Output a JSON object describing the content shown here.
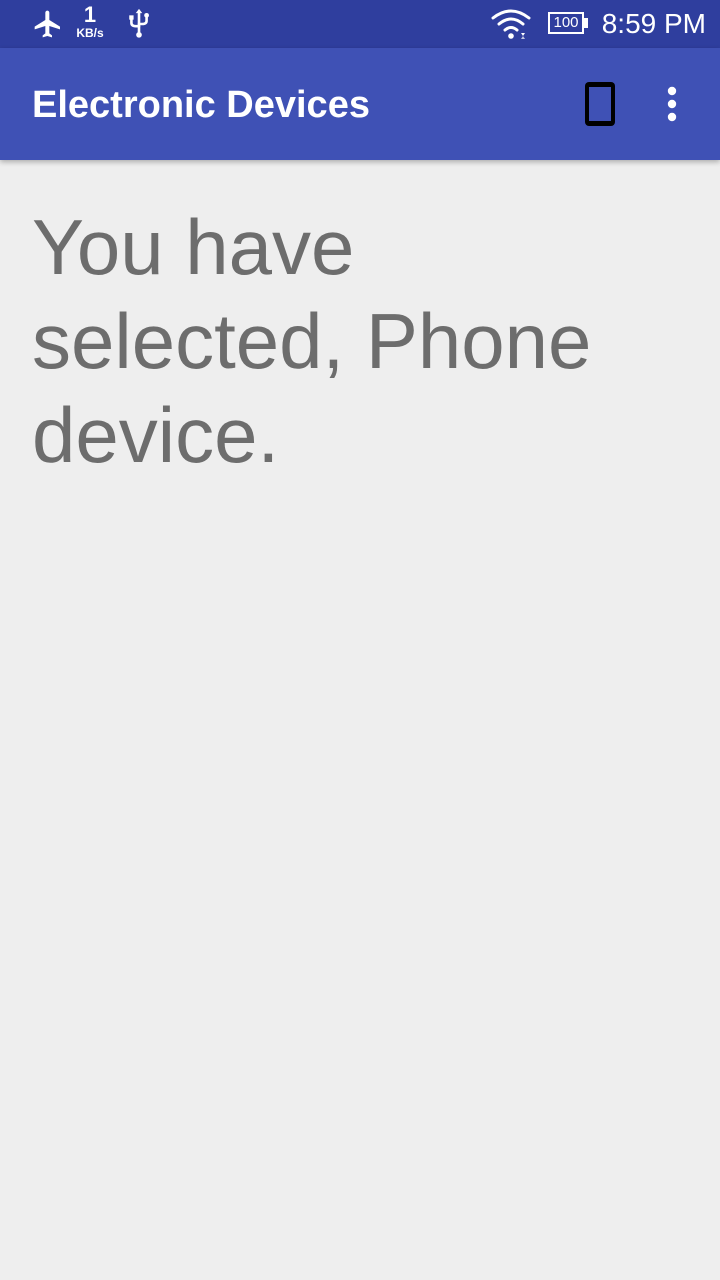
{
  "status_bar": {
    "airplane_icon": "airplane-icon",
    "net_speed_value": "1",
    "net_speed_unit": "KB/s",
    "usb_icon": "usb-icon",
    "wifi_icon": "wifi-icon",
    "battery_level": "100",
    "time": "8:59 PM"
  },
  "app_bar": {
    "title": "Electronic Devices",
    "actions": [
      {
        "icon": "phone-icon"
      },
      {
        "icon": "more-vert-icon"
      }
    ],
    "background_color": "#3f51b5"
  },
  "main": {
    "message": "You have selected, Phone device."
  }
}
